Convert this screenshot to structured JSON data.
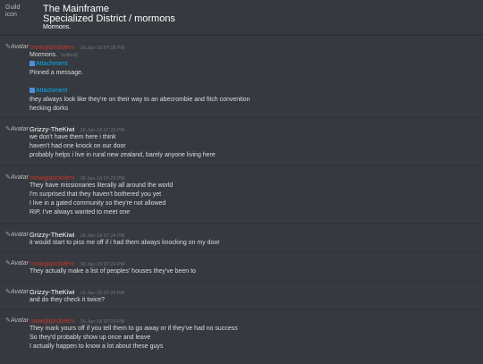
{
  "header": {
    "guild_icon_alt": "Guild icon",
    "guild_name": "The Mainframe",
    "channel": "Specialized District / mormons",
    "topic": "Mormons."
  },
  "avatar_alt": "Avatar",
  "colors": {
    "background": "#36393f",
    "red_author": "#c0392b",
    "link": "#00b0f4"
  },
  "messages": [
    {
      "author": "mowgliproblem",
      "timestamp": "16-Jan-18 07:18 PM",
      "lines": [
        "Mormons.",
        "",
        "Pinned a message.",
        "",
        "they always look like they're on their way to an abecrombie and fitch convention",
        "hecking dorks"
      ],
      "edited": "(edited)",
      "attachment1": "Attachment",
      "attachment2": "Attachment"
    },
    {
      "author": "Grizzy-TheKiwi",
      "timestamp": "16-Jan-18 07:23 PM",
      "lines": [
        "we don't have them here i think",
        "haven't had one knock on our door",
        "probably helps i live in rural new zealand, barely anyone living here"
      ]
    },
    {
      "author": "mowgliproblem",
      "timestamp": "16-Jan-18 07:23 PM",
      "lines": [
        "They have missionaries literally all around the world",
        "I'm surprised that they haven't bothered you yet",
        "I live in a gated community so they're not allowed",
        "RIP, I've always wanted to meet one"
      ]
    },
    {
      "author": "Grizzy-TheKiwi",
      "timestamp": "16-Jan-18 07:24 PM",
      "lines": [
        "it would start to piss me off if i had them always knocking on my door"
      ]
    },
    {
      "author": "mowgliproblem",
      "timestamp": "16-Jan-18 07:24 PM",
      "lines": [
        "They actually make a list of peoples' houses they've been to"
      ]
    },
    {
      "author": "Grizzy-TheKiwi",
      "timestamp": "16-Jan-18 07:24 PM",
      "lines": [
        "and do they check it twice?"
      ]
    },
    {
      "author": "mowgliproblem",
      "timestamp": "16-Jan-18 07:24 PM",
      "lines": [
        "They mark yours off if you tell them to go away or if they've had no success",
        "So they'd probably show up once and leave",
        "I actually happen to know a lot about these guys"
      ]
    }
  ]
}
